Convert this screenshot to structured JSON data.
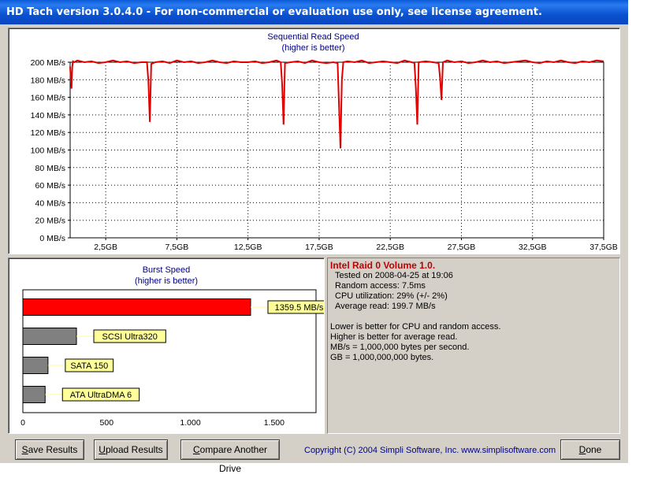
{
  "window": {
    "title": "HD Tach version 3.0.4.0  - For non-commercial or evaluation use only, see license agreement."
  },
  "sequential": {
    "title_line1": "Sequential Read Speed",
    "title_line2": "(higher is better)"
  },
  "burst_chart": {
    "title_line1": "Burst Speed",
    "title_line2": "(higher is better)"
  },
  "info": {
    "drive": "Intel Raid 0 Volume 1.0.",
    "tested": "Tested on 2008-04-25 at 19:06",
    "random_access": "Random access: 7.5ms",
    "cpu": "CPU utilization: 29% (+/- 2%)",
    "avg_read": "Average read: 199.7 MB/s",
    "note1": "Lower is better for CPU and random access.",
    "note2": "Higher is better for average read.",
    "note3": "MB/s = 1,000,000 bytes per second.",
    "note4": "GB = 1,000,000,000 bytes."
  },
  "buttons": {
    "save_underline": "S",
    "save_rest": "ave Results",
    "upload_underline": "U",
    "upload_rest": "pload Results",
    "compare_underline": "C",
    "compare_rest": "ompare Another Drive",
    "done_underline": "D",
    "done_rest": "one"
  },
  "copyright": "Copyright (C) 2004 Simpli Software, Inc. www.simplisoftware.com",
  "colors": {
    "titlebar": "#0a52d0",
    "read_line": "#e00000",
    "burst_main": "#ff0000",
    "burst_other": "#808080",
    "label_bg": "#ffff99",
    "chart_title": "#000080"
  },
  "chart_data": [
    {
      "type": "line",
      "title": "Sequential Read Speed",
      "subtitle": "(higher is better)",
      "xlabel": "",
      "ylabel": "",
      "xlim": [
        0,
        37.5
      ],
      "ylim": [
        0,
        200
      ],
      "x_ticks": [
        "2,5GB",
        "7,5GB",
        "12,5GB",
        "17,5GB",
        "22,5GB",
        "27,5GB",
        "32,5GB",
        "37,5GB"
      ],
      "x_tick_values": [
        2.5,
        7.5,
        12.5,
        17.5,
        22.5,
        27.5,
        32.5,
        37.5
      ],
      "y_ticks": [
        "0 MB/s",
        "20 MB/s",
        "40 MB/s",
        "60 MB/s",
        "80 MB/s",
        "100 MB/s",
        "120 MB/s",
        "140 MB/s",
        "160 MB/s",
        "180 MB/s",
        "200 MB/s"
      ],
      "y_tick_values": [
        0,
        20,
        40,
        60,
        80,
        100,
        120,
        140,
        160,
        180,
        200
      ],
      "grid": true,
      "series": [
        {
          "x": [
            0,
            0.05,
            0.1,
            0.15,
            0.2,
            0.3,
            0.5,
            1,
            1.5,
            2,
            2.5,
            3,
            3.5,
            4,
            4.5,
            5,
            5.4,
            5.5,
            5.6,
            5.7,
            6,
            6.5,
            7,
            7.5,
            8,
            8.5,
            9,
            9.5,
            10,
            10.5,
            11,
            11.5,
            12,
            12.5,
            13,
            13.5,
            14,
            14.5,
            14.8,
            14.9,
            15.0,
            15.1,
            15.5,
            16,
            16.5,
            17,
            17.5,
            18,
            18.5,
            18.8,
            18.9,
            19.0,
            19.1,
            19.2,
            19.5,
            20,
            20.5,
            21,
            21.5,
            22,
            22.5,
            23,
            23.5,
            24,
            24.2,
            24.3,
            24.4,
            24.5,
            25,
            25.5,
            25.9,
            26.0,
            26.1,
            26.2,
            26.5,
            27,
            27.5,
            28,
            28.5,
            29,
            29.5,
            30,
            30.5,
            31,
            31.5,
            32,
            32.5,
            33,
            33.5,
            34,
            34.5,
            35,
            35.5,
            36,
            36.5,
            37,
            37.5
          ],
          "y": [
            195,
            180,
            170,
            195,
            201,
            200,
            202,
            200,
            201,
            199,
            200,
            202,
            200,
            201,
            199,
            200,
            200,
            178,
            132,
            198,
            200,
            201,
            199,
            202,
            200,
            201,
            199,
            200,
            202,
            200,
            199,
            201,
            200,
            200,
            201,
            199,
            200,
            202,
            200,
            175,
            129,
            199,
            200,
            201,
            199,
            202,
            200,
            199,
            200,
            199,
            150,
            102,
            180,
            200,
            201,
            200,
            202,
            199,
            200,
            201,
            200,
            199,
            202,
            200,
            199,
            170,
            129,
            200,
            201,
            200,
            199,
            182,
            157,
            200,
            202,
            200,
            201,
            199,
            200,
            202,
            200,
            201,
            199,
            200,
            201,
            202,
            200,
            199,
            201,
            200,
            202,
            200,
            199,
            201,
            200,
            202,
            201
          ]
        }
      ]
    },
    {
      "type": "bar",
      "orientation": "horizontal",
      "title": "Burst Speed",
      "subtitle": "(higher is better)",
      "categories": [
        "1359.5 MB/s",
        "SCSI Ultra320",
        "SATA 150",
        "ATA UltraDMA 6"
      ],
      "values": [
        1359.5,
        320,
        150,
        133
      ],
      "xlim": [
        0,
        1750
      ],
      "x_ticks": [
        "0",
        "500",
        "1.000",
        "1.500"
      ],
      "x_tick_values": [
        0,
        500,
        1000,
        1500
      ]
    }
  ]
}
